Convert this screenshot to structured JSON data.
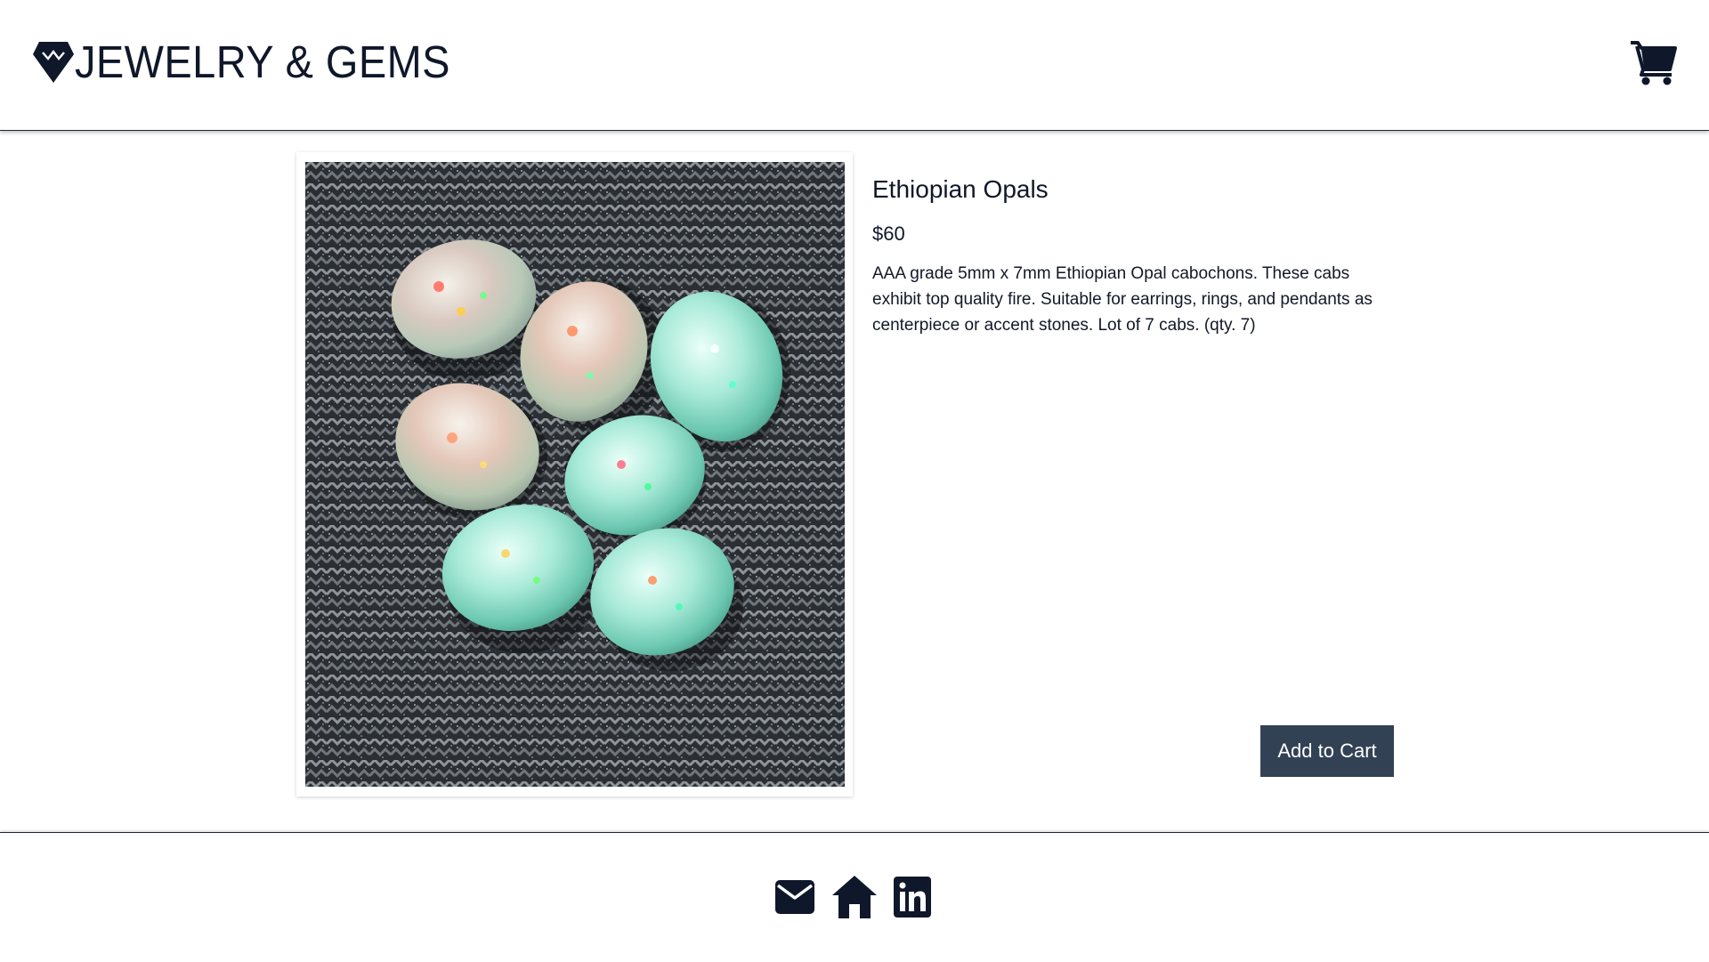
{
  "header": {
    "brand_text": "JEWELRY & GEMS",
    "logo_icon": "gem-icon",
    "cart_icon": "shopping-cart-icon"
  },
  "product": {
    "name": "Ethiopian Opals",
    "price": "$60",
    "description": "AAA grade 5mm x 7mm Ethiopian Opal cabochons. These cabs exhibit top quality fire. Suitable for earrings, rings, and pendants as centerpiece or accent stones. Lot of 7 cabs. (qty. 7)",
    "image_icon": "opal-cabochons-photo",
    "add_to_cart_label": "Add to Cart"
  },
  "footer": {
    "icons": [
      "envelope-icon",
      "home-icon",
      "linkedin-icon"
    ]
  },
  "colors": {
    "text_dark": "#0f172a",
    "button_bg": "#334155",
    "button_text": "#ffffff",
    "border": "#1f2937"
  }
}
